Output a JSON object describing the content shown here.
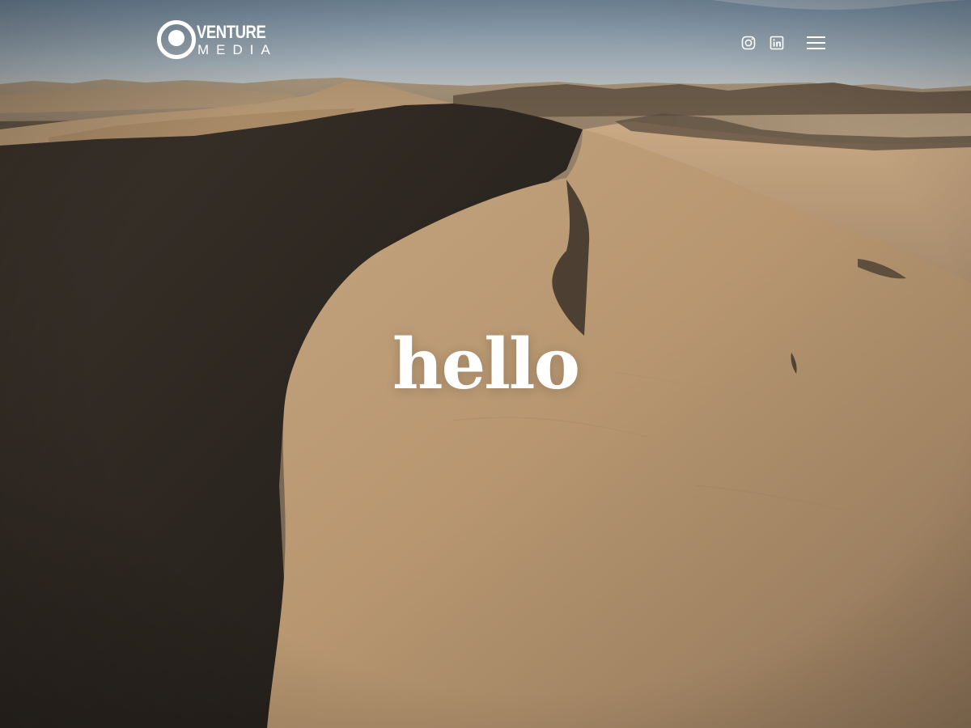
{
  "brand": {
    "name_line1": "VENTURE",
    "name_line2": "MEDIA"
  },
  "nav": {
    "social_links": [
      {
        "icon": "instagram-icon"
      },
      {
        "icon": "linkedin-icon"
      }
    ],
    "menu_icon": "hamburger-menu-icon"
  },
  "hero": {
    "headline": "hello",
    "background": "desert dune"
  },
  "colors": {
    "text": "#ffffff",
    "sky_top": "#7f97ab",
    "sand_light": "#c6a67e",
    "shadow": "#26201a"
  }
}
